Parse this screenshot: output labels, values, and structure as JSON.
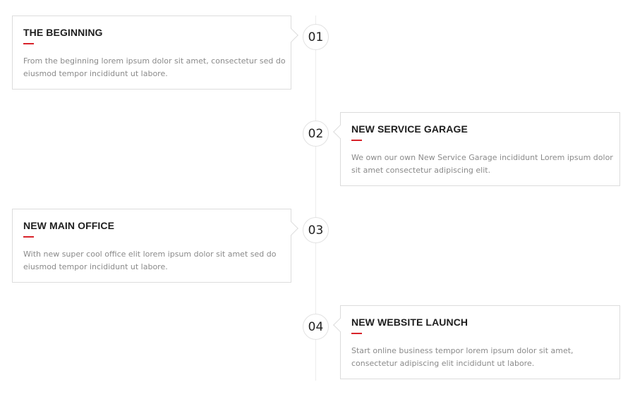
{
  "timeline": {
    "items": [
      {
        "number": "01",
        "title": "THE BEGINNING",
        "text": "From the beginning lorem ipsum dolor sit amet, consectetur sed do eiusmod tempor incididunt ut labore."
      },
      {
        "number": "02",
        "title": "NEW SERVICE GARAGE",
        "text": "We own our own New Service Garage incididunt Lorem ipsum dolor sit amet consectetur adipiscing elit."
      },
      {
        "number": "03",
        "title": "NEW MAIN OFFICE",
        "text": "With new super cool office elit lorem ipsum dolor sit amet sed do eiusmod tempor incididunt ut labore."
      },
      {
        "number": "04",
        "title": "NEW WEBSITE LAUNCH",
        "text": "Start online business tempor lorem ipsum dolor sit amet, consectetur adipiscing elit incididunt ut labore."
      }
    ]
  },
  "colors": {
    "accent": "#d8232a",
    "title": "#1e1e1e",
    "body_text": "#8a8a8a",
    "border": "#dcdcdc"
  }
}
